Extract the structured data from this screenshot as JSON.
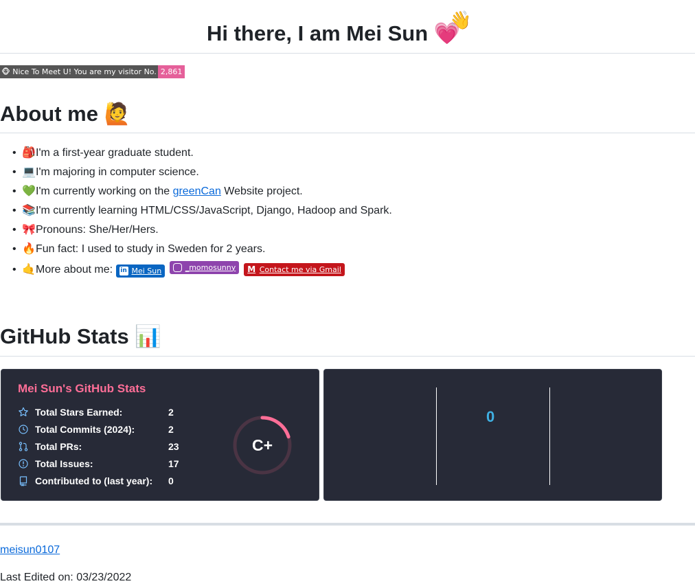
{
  "header": {
    "title": "Hi there, I am Mei Sun",
    "heart_emoji": "💗",
    "wave_emoji": "👋"
  },
  "visitor_badge": {
    "label": "Nice To Meet U! You are my visitor No.",
    "icon": "🐵",
    "count": "2,861"
  },
  "about": {
    "heading": "About me",
    "heading_emoji": "🙋",
    "items": [
      {
        "emoji": "🎒",
        "text": "I'm a first-year graduate student."
      },
      {
        "emoji": "💻",
        "text": "I'm majoring in computer science."
      },
      {
        "emoji": "💚",
        "text_before": "I'm currently working on the ",
        "link": "greenCan",
        "text_after": " Website project."
      },
      {
        "emoji": "📚",
        "text": "I'm currently learning HTML/CSS/JavaScript, Django, Hadoop and Spark."
      },
      {
        "emoji": "🎀",
        "text": "Pronouns: She/Her/Hers."
      },
      {
        "emoji": "🔥",
        "text": "Fun fact: I used to study in Sweden for 2 years."
      },
      {
        "emoji": "🤙",
        "text": "More about me: "
      }
    ],
    "badges": {
      "linkedin": {
        "icon": "in",
        "label": "Mei Sun",
        "color": "#0a66c2"
      },
      "instagram": {
        "icon": "instagram-icon",
        "label": "_momosunny",
        "color": "#8e44ad"
      },
      "gmail": {
        "icon": "M",
        "label": "Contact me via Gmail",
        "color": "#c4161c"
      }
    }
  },
  "stats": {
    "heading": "GitHub Stats",
    "heading_emoji": "📊",
    "card": {
      "title": "Mei Sun's GitHub Stats",
      "title_color": "#fe6e97",
      "rows": [
        {
          "icon": "star-icon",
          "label": "Total Stars Earned:",
          "value": "2"
        },
        {
          "icon": "history-icon",
          "label": "Total Commits (2024):",
          "value": "2"
        },
        {
          "icon": "pull-request-icon",
          "label": "Total PRs:",
          "value": "23"
        },
        {
          "icon": "issue-icon",
          "label": "Total Issues:",
          "value": "17"
        },
        {
          "icon": "repo-icon",
          "label": "Contributed to (last year):",
          "value": "0"
        }
      ],
      "rank": "C+",
      "rank_progress": 0.2
    },
    "streak": {
      "value": "0",
      "color": "#3fb0e3"
    }
  },
  "footer": {
    "link": "meisun0107",
    "last_edited": "Last Edited on: 03/23/2022"
  }
}
